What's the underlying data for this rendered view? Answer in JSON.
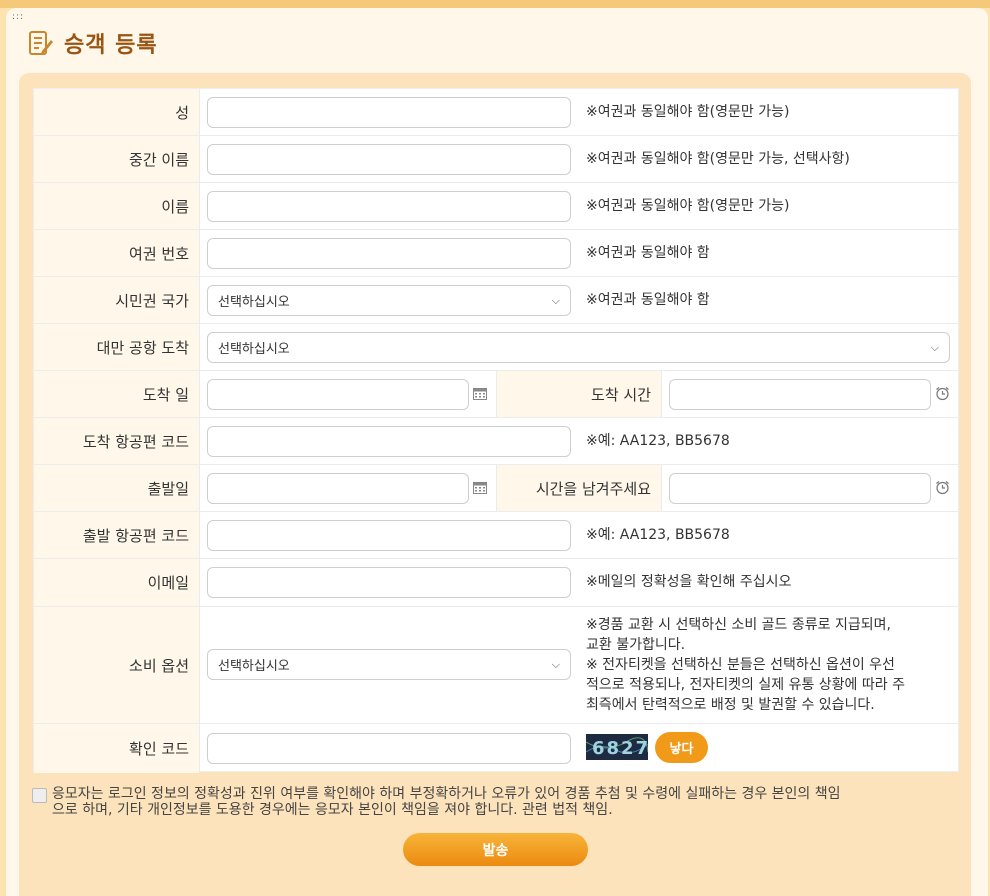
{
  "page": {
    "title": "승객 등록",
    "drag_handle": ":::"
  },
  "form": {
    "last_name": {
      "label": "성",
      "note": "※여권과 동일해야 함(영문만 가능)"
    },
    "middle_name": {
      "label": "중간 이름",
      "note": "※여권과 동일해야 함(영문만 가능, 선택사항)"
    },
    "first_name": {
      "label": "이름",
      "note": "※여권과 동일해야 함(영문만 가능)"
    },
    "passport": {
      "label": "여권 번호",
      "note": "※여권과 동일해야 함"
    },
    "citizenship": {
      "label": "시민권 국가",
      "value": "선택하십시오",
      "note": "※여권과 동일해야 함"
    },
    "airport": {
      "label": "대만 공항 도착",
      "value": "선택하십시오"
    },
    "arrival_date": {
      "label": "도착 일"
    },
    "arrival_time": {
      "label": "도착 시간"
    },
    "arrival_flight": {
      "label": "도착 항공편 코드",
      "note": "※예: AA123, BB5678"
    },
    "departure_date": {
      "label": "출발일"
    },
    "departure_time": {
      "label": "시간을 남겨주세요"
    },
    "departure_flight": {
      "label": "출발 항공편 코드",
      "note": "※예: AA123, BB5678"
    },
    "email": {
      "label": "이메일",
      "note": "※메일의 정확성을 확인해 주십시오"
    },
    "consumption": {
      "label": "소비 옵션",
      "value": "선택하십시오",
      "note_lines": [
        "※경품 교환 시 선택하신 소비 골드 종류로 지급되며,",
        "교환 불가합니다.",
        "※ 전자티켓을 선택하신 분들은 선택하신 옵션이 우선",
        "적으로 적용되나, 전자티켓의 실제 유통 상황에 따라 주",
        "최즉에서 탄력적으로 배정 및 발권할 수 있습니다."
      ]
    },
    "verify": {
      "label": "확인 코드",
      "captcha_text": "6827",
      "refresh_label": "낳다"
    }
  },
  "agreement": {
    "line1": "응모자는 로그인 정보의 정확성과 진위 여부를 확인해야 하며 부정확하거나 오류가 있어 경품 추첨 및 수령에 실패하는 경우 본인의 책임",
    "line2": "으로 하며, 기타 개인정보를 도용한 경우에는 응모자 본인이 책임을 져야 합니다. 관련 법적 책임."
  },
  "submit_label": "발송",
  "colors": {
    "accent": "#f19a1a",
    "title": "#9a5412",
    "label_bg": "#fff8ea"
  }
}
